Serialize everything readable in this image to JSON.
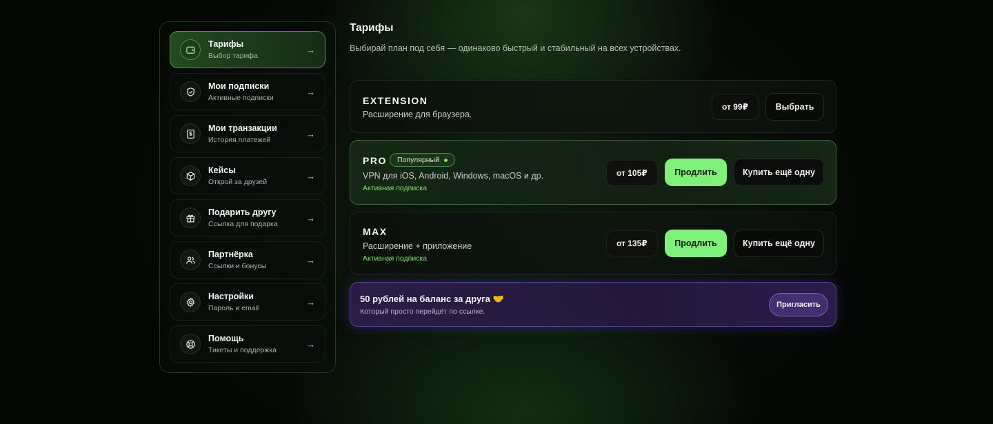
{
  "sidebar": {
    "items": [
      {
        "title": "Тарифы",
        "subtitle": "Выбор тарифа",
        "icon": "wallet-icon",
        "active": true
      },
      {
        "title": "Мои подписки",
        "subtitle": "Активные подписки",
        "icon": "shield-check-icon"
      },
      {
        "title": "Мои транзакции",
        "subtitle": "История платежей",
        "icon": "receipt-dollar-icon"
      },
      {
        "title": "Кейсы",
        "subtitle": "Открой за друзей",
        "icon": "box-icon"
      },
      {
        "title": "Подарить другу",
        "subtitle": "Ссылка для подарка",
        "icon": "gift-icon"
      },
      {
        "title": "Партнёрка",
        "subtitle": "Ссылки и бонусы",
        "icon": "users-icon"
      },
      {
        "title": "Настройки",
        "subtitle": "Пароль и email",
        "icon": "gear-icon"
      },
      {
        "title": "Помощь",
        "subtitle": "Тикеты и поддержка",
        "icon": "lifebuoy-icon"
      }
    ],
    "arrow": "→"
  },
  "main": {
    "title": "Тарифы",
    "subtitle": "Выбирай план под себя — одинаково быстрый и стабильный на всех устройствах.",
    "plans": [
      {
        "name": "EXTENSION",
        "description": "Расширение для браузера.",
        "price": "от 99₽",
        "select_label": "Выбрать"
      },
      {
        "name": "PRO",
        "badge": "Популярный",
        "description": "VPN для iOS, Android, Windows, macOS и др.",
        "status": "Активная подписка",
        "price": "от 105₽",
        "renew_label": "Продлить",
        "buy_more_label": "Купить ещё одну"
      },
      {
        "name": "MAX",
        "description": "Расширение + приложение",
        "status": "Активная подписка",
        "price": "от 135₽",
        "renew_label": "Продлить",
        "buy_more_label": "Купить ещё одну"
      }
    ],
    "promo": {
      "title": "50 рублей на баланс за друга 🤝",
      "subtitle": "Который просто перейдёт по ссылке.",
      "button_label": "Пригласить"
    }
  },
  "colors": {
    "accent": "#7ff07a",
    "status_green": "#7fe070",
    "promo_purple": "#2d1e4b",
    "background": "#050705"
  }
}
